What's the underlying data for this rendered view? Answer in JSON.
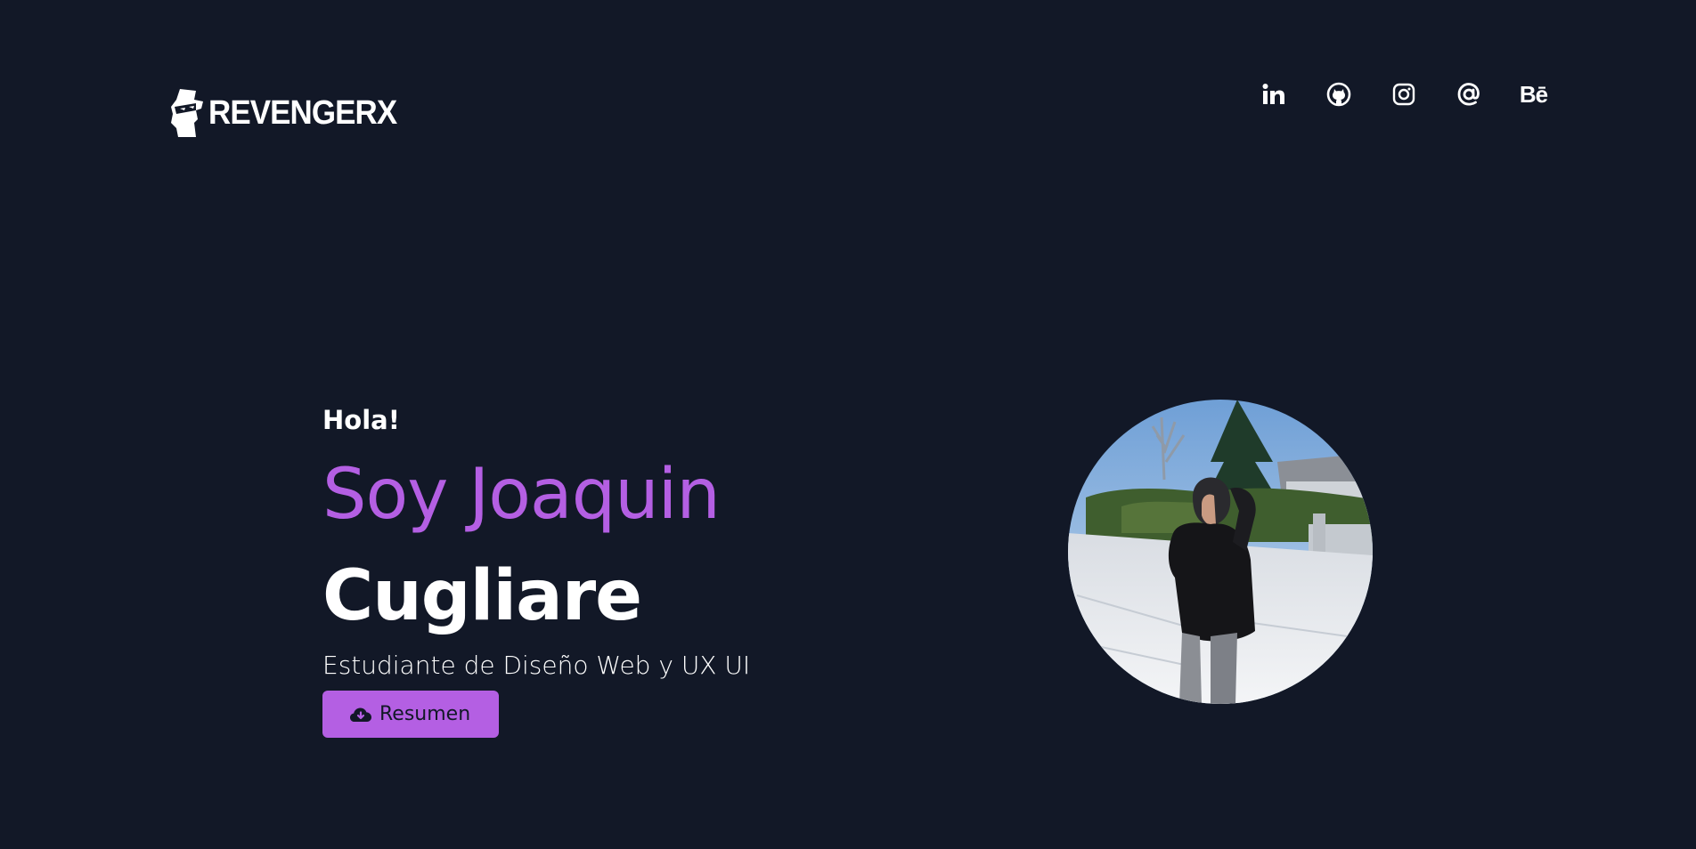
{
  "header": {
    "brand": "REVENGERX",
    "social": [
      {
        "name": "linkedin-icon",
        "label": "in"
      },
      {
        "name": "github-icon",
        "label": ""
      },
      {
        "name": "instagram-icon",
        "label": ""
      },
      {
        "name": "email-icon",
        "label": ""
      },
      {
        "name": "behance-icon",
        "label": "Bē"
      }
    ]
  },
  "hero": {
    "greeting": "Hola!",
    "name_first": "Soy Joaquin",
    "name_last": "Cugliare",
    "subtitle": "Estudiante de Diseño Web y UX UI",
    "button_label": "Resumen",
    "button_icon": "cloud-download-icon"
  },
  "colors": {
    "background": "#121827",
    "accent": "#b45fe3",
    "text": "#ffffff"
  }
}
